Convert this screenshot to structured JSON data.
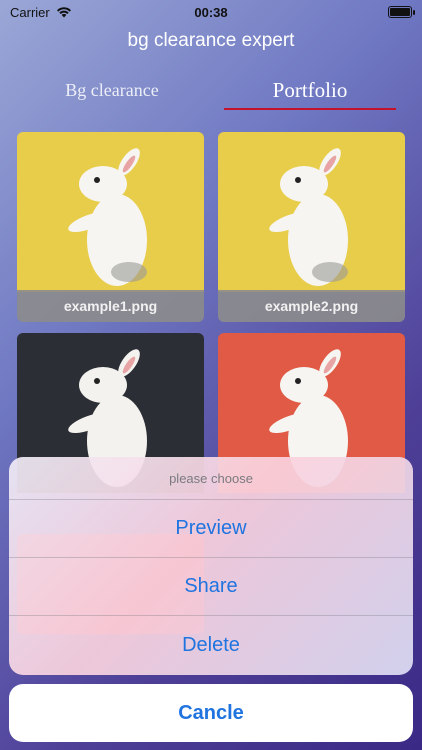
{
  "status": {
    "carrier": "Carrier",
    "time": "00:38"
  },
  "app": {
    "title": "bg clearance expert"
  },
  "tabs": [
    {
      "label": "Bg clearance",
      "selected": false
    },
    {
      "label": "Portfolio",
      "selected": true
    }
  ],
  "gallery": {
    "items": [
      {
        "label": "example1.png",
        "background": "#e8cd4b"
      },
      {
        "label": "example2.png",
        "background": "#e8cd4b"
      },
      {
        "label": "",
        "background": "#2c2e35"
      },
      {
        "label": "",
        "background": "#e15a45"
      }
    ]
  },
  "action_sheet": {
    "title": "please choose",
    "actions": [
      "Preview",
      "Share",
      "Delete"
    ],
    "cancel_label": "Cancle"
  },
  "colors": {
    "accent": "#1f74e0",
    "tab_indicator": "#c4122b"
  }
}
